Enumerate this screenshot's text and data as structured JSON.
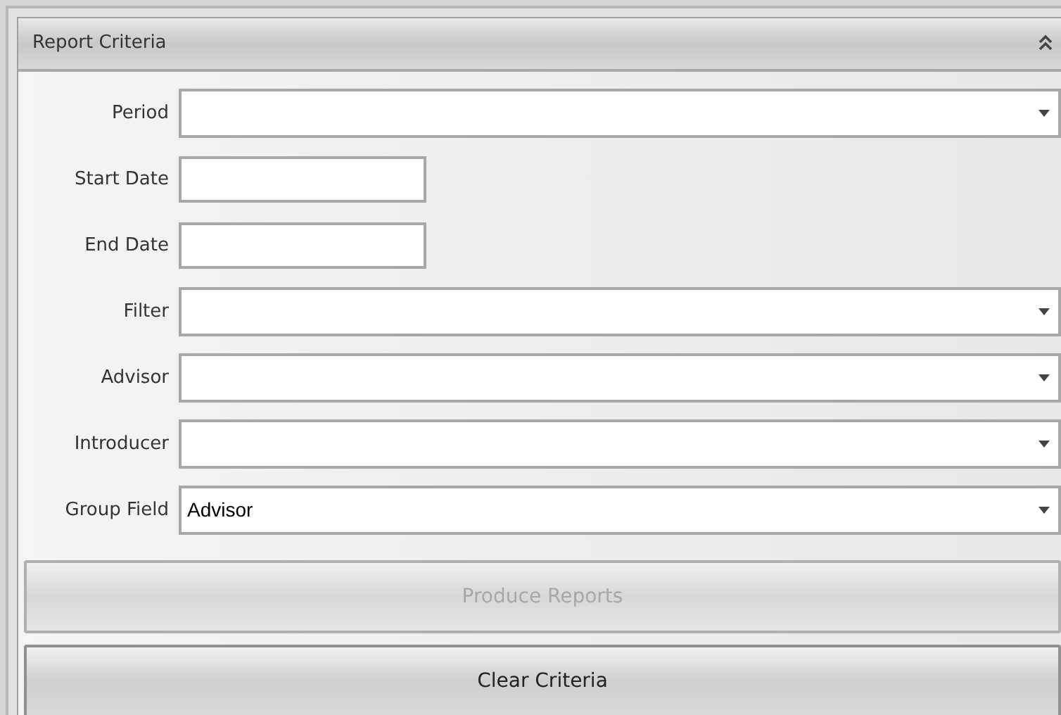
{
  "panel": {
    "title": "Report Criteria",
    "expanded": true
  },
  "fields": [
    {
      "label": "Period",
      "kind": "dropdown"
    },
    {
      "label": "Start Date",
      "kind": "text"
    },
    {
      "label": "End Date",
      "kind": "text"
    },
    {
      "label": "Filter",
      "kind": "dropdown"
    },
    {
      "label": "Advisor",
      "kind": "dropdown"
    },
    {
      "label": "Introducer",
      "kind": "dropdown"
    },
    {
      "label": "Group Field",
      "kind": "dropdown",
      "value": "Advisor"
    }
  ],
  "buttons": [
    {
      "label": "Produce Reports",
      "disabled": true
    },
    {
      "label": "Clear Criteria",
      "disabled": false
    }
  ]
}
